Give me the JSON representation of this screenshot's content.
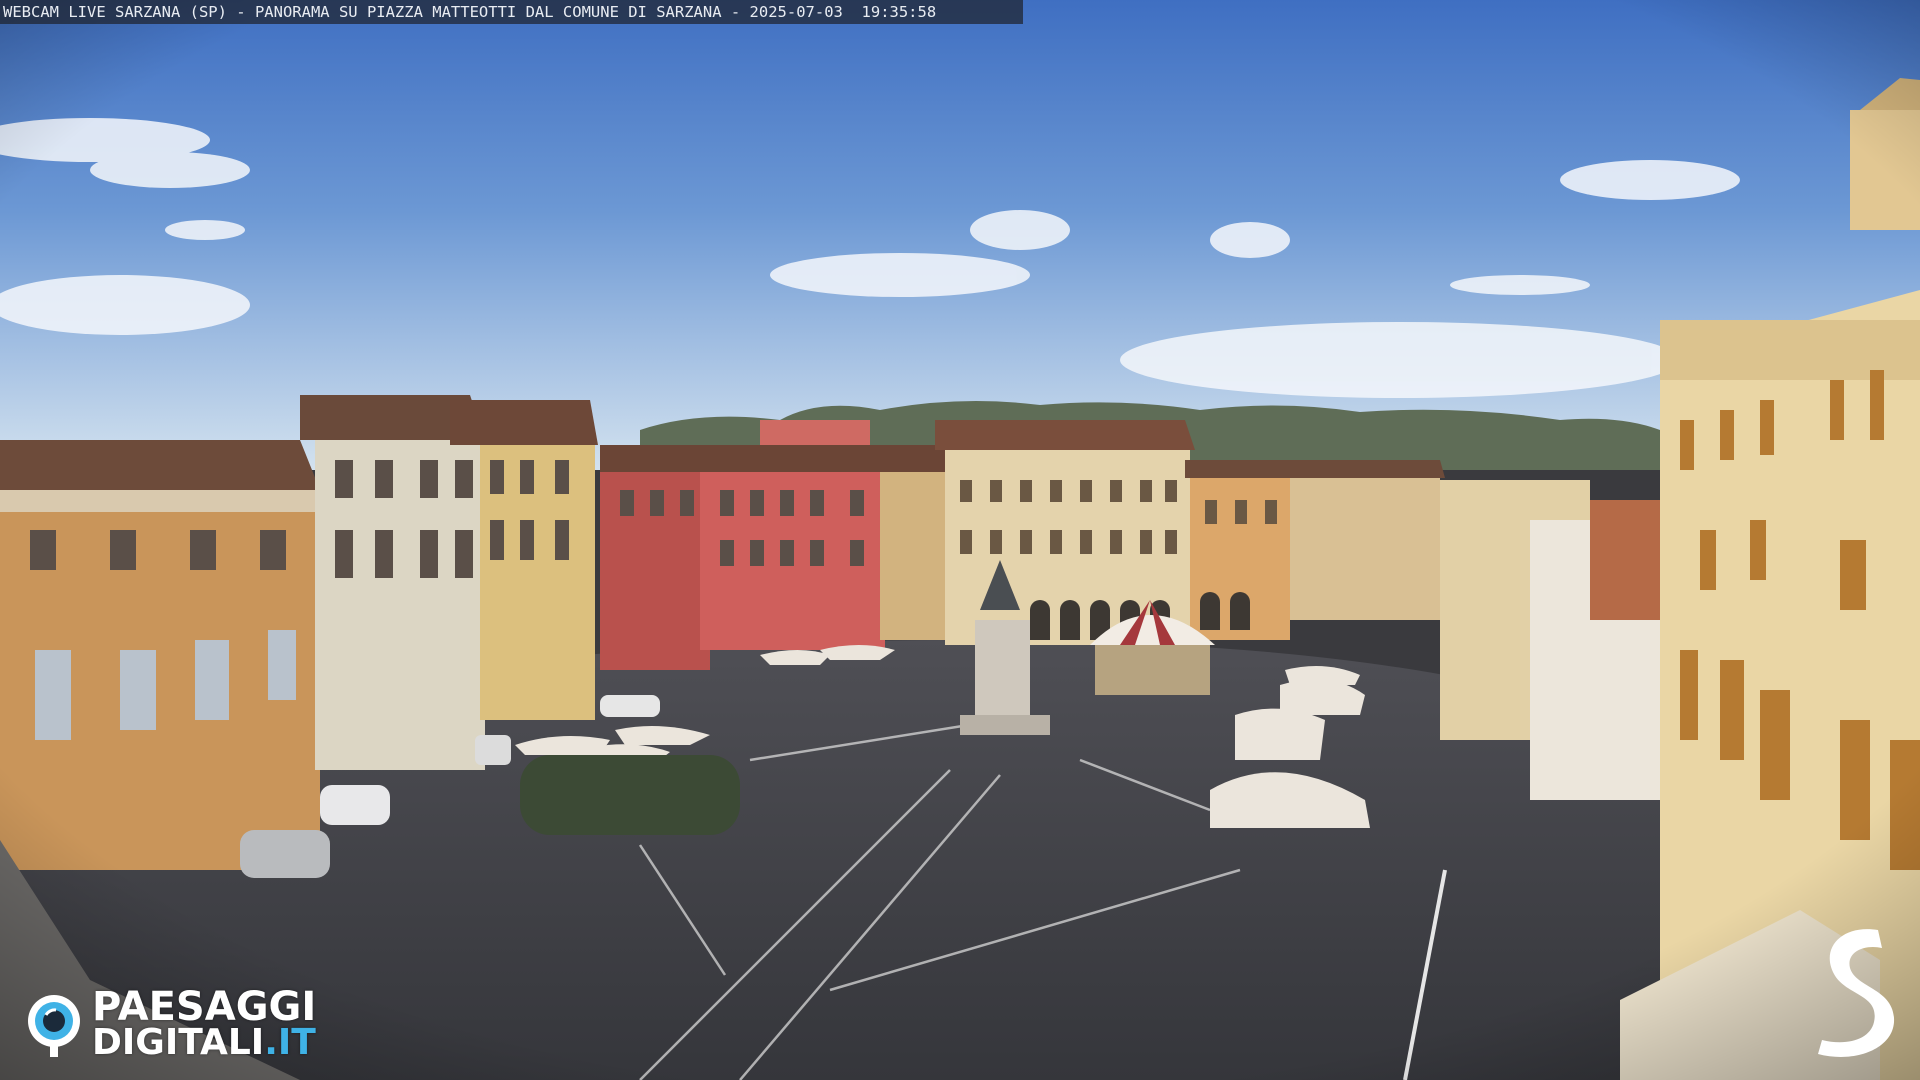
{
  "overlay": {
    "caption": "WEBCAM LIVE SARZANA (SP) - PANORAMA SU PIAZZA MATTEOTTI DAL COMUNE DI SARZANA - 2025-07-03  19:35:58"
  },
  "brand": {
    "name_line1": "PAESAGGI",
    "name_line2_main": "DIGITALI",
    "name_line2_tld": ".IT",
    "icon": "camera-lens-icon"
  },
  "corner_logo": {
    "icon": "s-logo-icon"
  },
  "colors": {
    "sky_top": "#4a79c9",
    "sky_horizon": "#cfe0f0",
    "pavement": "#45464c",
    "brand_accent": "#3fb2e6"
  }
}
